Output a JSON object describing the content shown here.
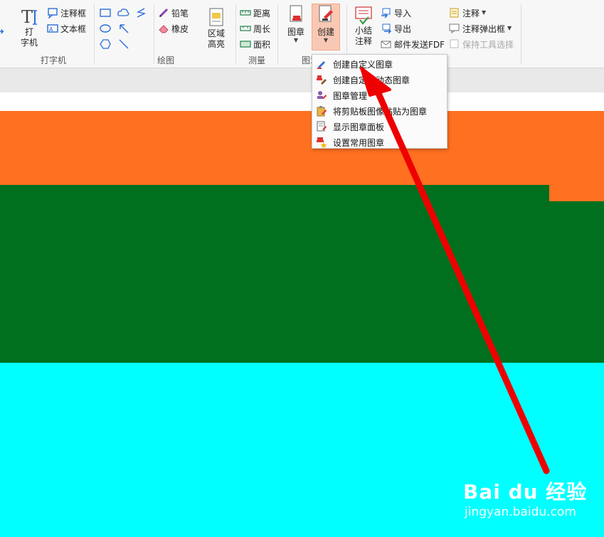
{
  "ribbon": {
    "typewriter_group": {
      "label": "打字机",
      "typewriter_btn_line1": "打",
      "typewriter_btn_line2": "字机",
      "callout_label": "注释框",
      "textbox_label": "文本框"
    },
    "draw_group": {
      "label": "绘图",
      "pencil_label": "铅笔",
      "eraser_label": "橡皮",
      "area_highlight_line1": "区域",
      "area_highlight_line2": "高亮"
    },
    "measure_group": {
      "label": "测量",
      "distance_label": "距离",
      "perimeter_label": "周长",
      "area_label": "面积"
    },
    "stamp_group": {
      "label": "图章",
      "stamp_label": "图章",
      "create_label": "创建"
    },
    "manage_group": {
      "summary_line1": "小结",
      "summary_line2": "注释",
      "import_label": "导入",
      "export_label": "导出",
      "email_fdf_label": "邮件发送FDF",
      "comment_label": "注释",
      "comment_popup_label": "注释弹出框",
      "keep_tool_label": "保持工具选择"
    }
  },
  "menu": {
    "items": [
      {
        "label": "创建自定义图章",
        "icon": "stamp-pen-icon"
      },
      {
        "label": "创建自定义动态图章",
        "icon": "dynamic-stamp-icon"
      },
      {
        "label": "图章管理",
        "icon": "stamp-manager-icon"
      },
      {
        "label": "将剪贴板图像粘贴为图章",
        "icon": "paste-stamp-icon"
      },
      {
        "label": "显示图章面板",
        "icon": "stamp-panel-icon"
      },
      {
        "label": "设置常用图章",
        "icon": "favorite-stamp-icon"
      }
    ]
  },
  "colors": {
    "orange": "#ff7020",
    "green": "#006f1e",
    "cyan": "#00ffff",
    "active_button": "#f9c8b4",
    "arrow": "#ee0000"
  },
  "watermark": {
    "logo": "Bai du 经验",
    "url": "jingyan.baidu.com"
  }
}
